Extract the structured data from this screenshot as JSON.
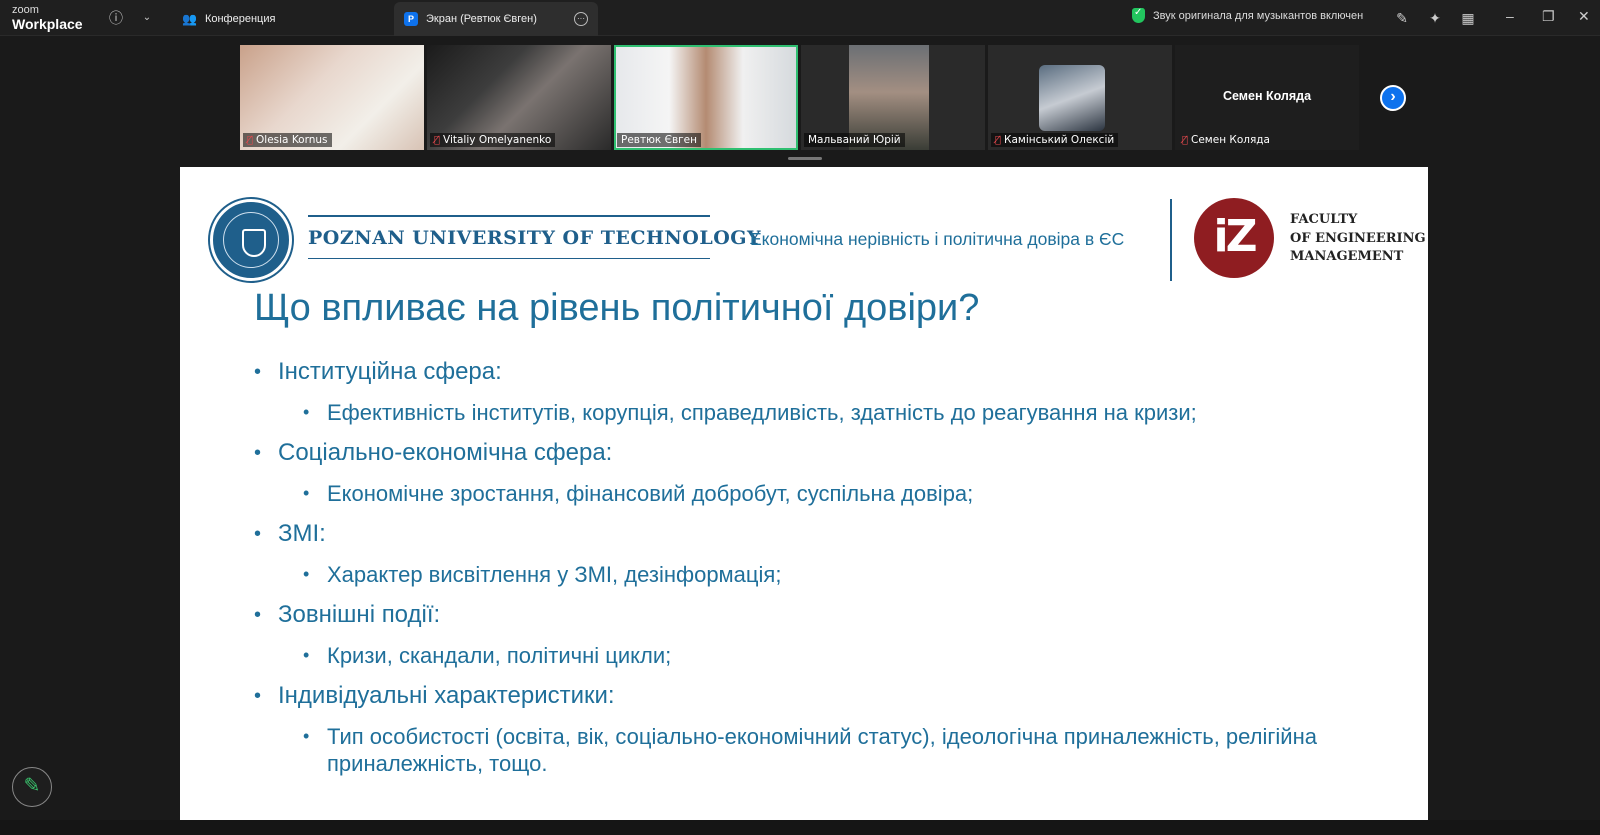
{
  "app": {
    "logo_line1": "zoom",
    "logo_line2": "Workplace"
  },
  "tabs": [
    {
      "label": "Конференция"
    },
    {
      "label": "Экран (Ревтюк Євген)",
      "badge": "P"
    }
  ],
  "notice": "Звук оригинала для музыкантов включен",
  "participants": [
    {
      "name": "Olesia Kornus",
      "muted": true
    },
    {
      "name": "Vitaliy Omelyanenko",
      "muted": true
    },
    {
      "name": "Ревтюк Євген",
      "muted": false,
      "speaking": true
    },
    {
      "name": "Мальваний Юрій",
      "muted": false
    },
    {
      "name": "Камінський Олексій",
      "muted": true
    },
    {
      "name": "Семен Коляда",
      "muted": true,
      "video_off": true
    }
  ],
  "slide": {
    "university": "POZNAN UNIVERSITY OF TECHNOLOGY",
    "subtitle": "Економічна нерівність і політична довіра в ЄС",
    "iz_logo": "iZ",
    "faculty_lines": [
      "FACULTY",
      "OF ENGINEERING",
      "MANAGEMENT"
    ],
    "title": "Що впливає на рівень політичної довіри?",
    "sections": [
      {
        "heading": "Інституційна сфера:",
        "detail": "Ефективність інститутів, корупція, справедливість, здатність до реагування на кризи;"
      },
      {
        "heading": "Соціально-економічна сфера:",
        "detail": "Економічне зростання, фінансовий добробут, суспільна довіра;"
      },
      {
        "heading": "ЗМІ:",
        "detail": "Характер висвітлення у ЗМІ, дезінформація;"
      },
      {
        "heading": "Зовнішні події:",
        "detail": "Кризи, скандали, політичні цикли;"
      },
      {
        "heading": "Індивідуальні характеристики:",
        "detail": "Тип особистості (освіта, вік, соціально-економічний статус), ідеологічна приналежність, релігійна приналежність, тощо."
      }
    ]
  }
}
